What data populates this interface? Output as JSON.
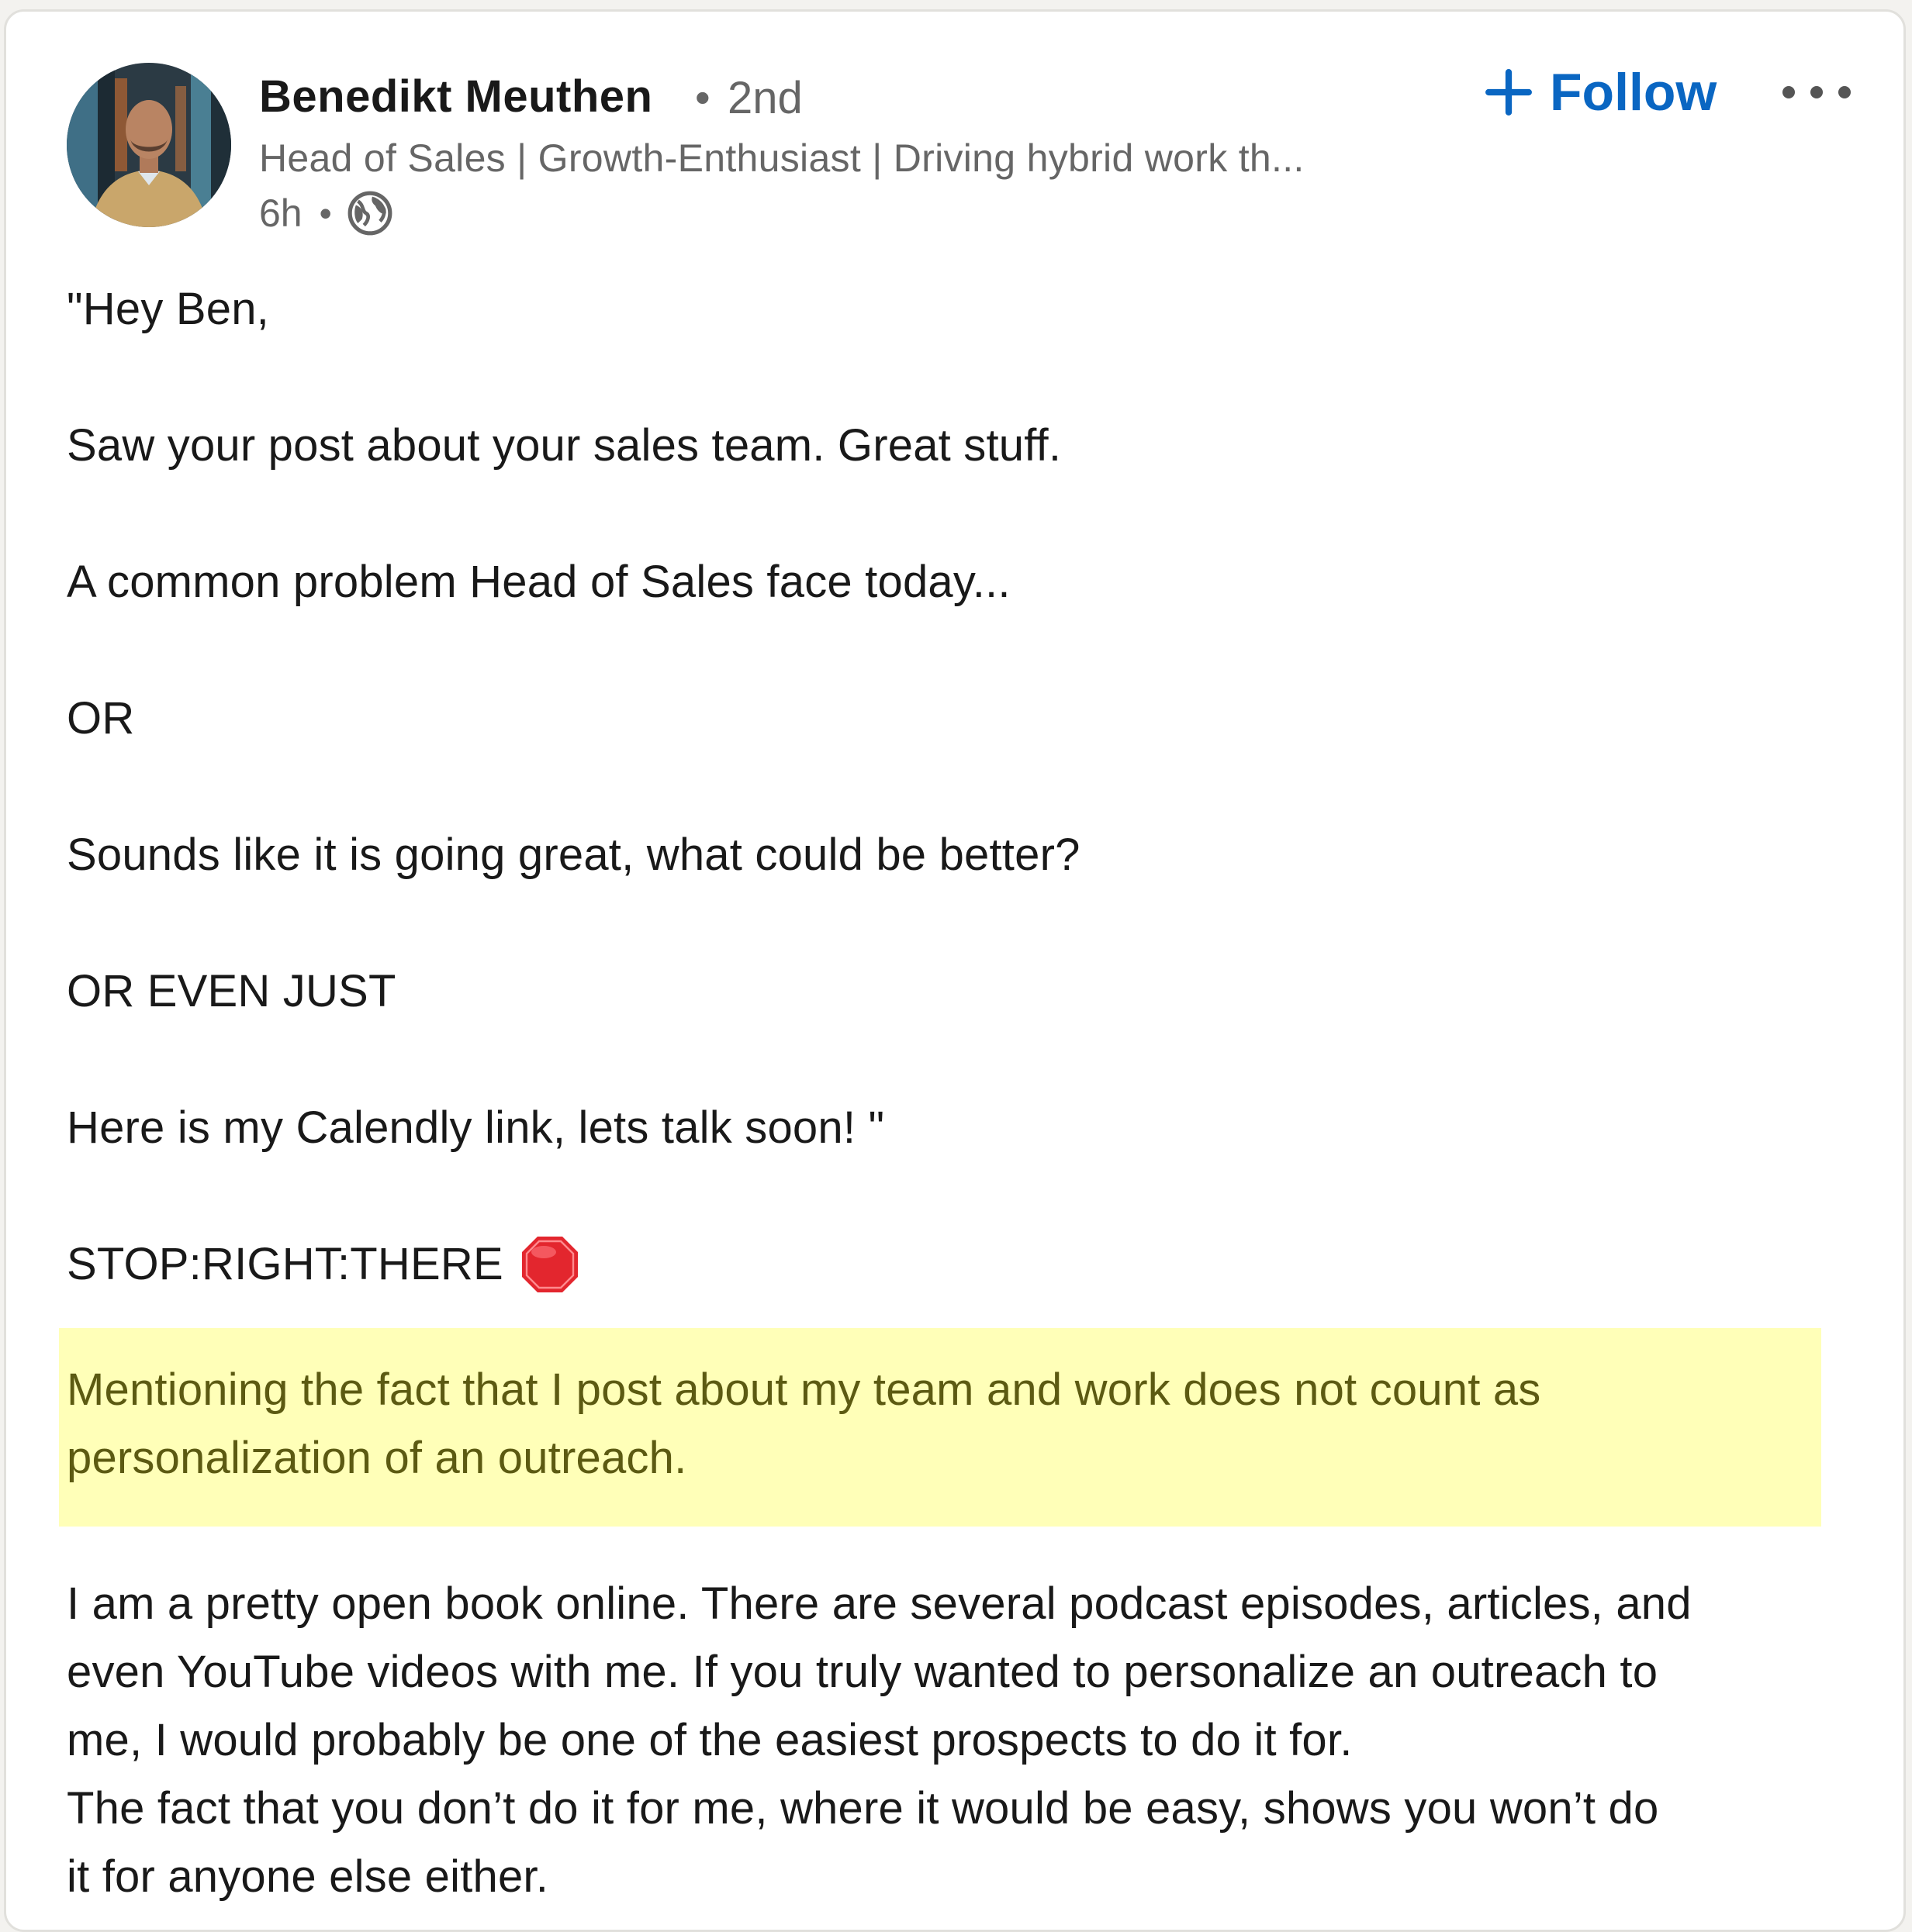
{
  "post": {
    "author": {
      "name": "Benedikt Meuthen",
      "degree": "2nd",
      "headline": "Head of Sales | Growth-Enthusiast | Driving hybrid work th...",
      "time": "6h",
      "visibility_icon": "globe-icon",
      "avatar_icon": "profile-photo"
    },
    "actions": {
      "follow_label": "Follow",
      "follow_icon": "plus-icon",
      "more_icon": "ellipsis-icon"
    },
    "body": {
      "paragraphs": [
        "\"Hey Ben,",
        "Saw your post about your sales team. Great stuff.",
        "A common problem Head of Sales face today...",
        "OR",
        "Sounds like it is going great, what could be better?",
        "OR EVEN JUST",
        "Here is my Calendly link, lets talk soon! \""
      ],
      "stop_line": "STOP:RIGHT:THERE",
      "stop_icon": "stop-sign-icon",
      "highlight": {
        "line1": "Mentioning the fact that I post about my team and work does not count as",
        "line2": "personalization of an outreach."
      },
      "closing": {
        "line1": "I am a pretty open book online. There are several podcast episodes, articles, and",
        "line2": "even YouTube videos with me. If you truly wanted to personalize an outreach to",
        "line3": "me, I would probably be one of the easiest prospects to do it for.",
        "line4": "The fact that you don’t do it for me, where it would be easy, shows you won’t do",
        "line5": "it for anyone else either."
      }
    },
    "colors": {
      "accent": "#0a66c2",
      "text": "#191919",
      "secondary_text": "#666666",
      "highlight_bg": "#ffffb8",
      "highlight_text": "#5c5a12",
      "stop_red": "#e3262e"
    }
  }
}
